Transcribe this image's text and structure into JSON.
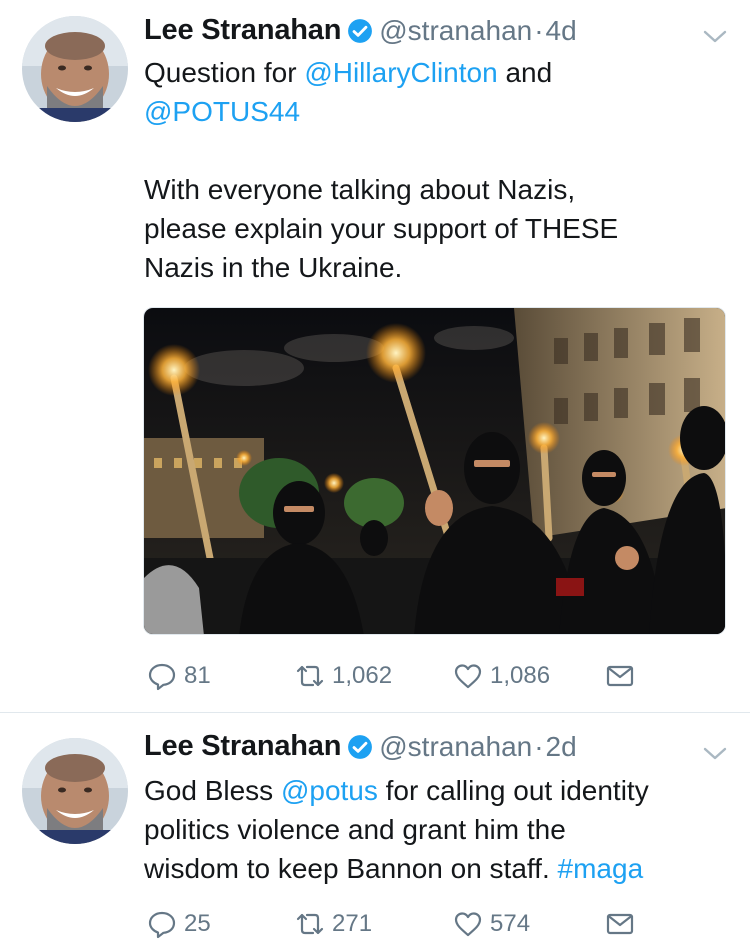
{
  "tweets": [
    {
      "author": {
        "name": "Lee Stranahan",
        "handle": "@stranahan",
        "verified_icon": "verified-badge-icon"
      },
      "separator": "·",
      "time": "4d",
      "text": {
        "line1_a": "Question for ",
        "line1_mention": "@HillaryClinton",
        "line1_b": " and",
        "line2_mention": "@POTUS44",
        "line3": "With everyone talking about Nazis,",
        "line4": "please explain your support of THESE",
        "line5": "Nazis in the Ukraine."
      },
      "media": {
        "type": "photo",
        "icon": "photo-torch-march"
      },
      "stats": {
        "replies": "81",
        "retweets": "1,062",
        "likes": "1,086"
      }
    },
    {
      "author": {
        "name": "Lee Stranahan",
        "handle": "@stranahan",
        "verified_icon": "verified-badge-icon"
      },
      "separator": "·",
      "time": "2d",
      "text": {
        "line1_a": "God Bless ",
        "line1_mention": "@potus",
        "line1_b": " for calling out identity",
        "line2": "politics violence and grant him the",
        "line3_a": "wisdom to keep Bannon on staff. ",
        "line3_hashtag": "#maga"
      },
      "stats": {
        "replies": "25",
        "retweets": "271",
        "likes": "574"
      }
    }
  ],
  "colors": {
    "accent": "#1da1f2",
    "text": "#14171a",
    "muted": "#657786",
    "divider": "#e1e8ed"
  },
  "icons": [
    "reply-icon",
    "retweet-icon",
    "like-icon",
    "direct-message-icon",
    "chevron-down-icon",
    "verified-badge-icon"
  ]
}
